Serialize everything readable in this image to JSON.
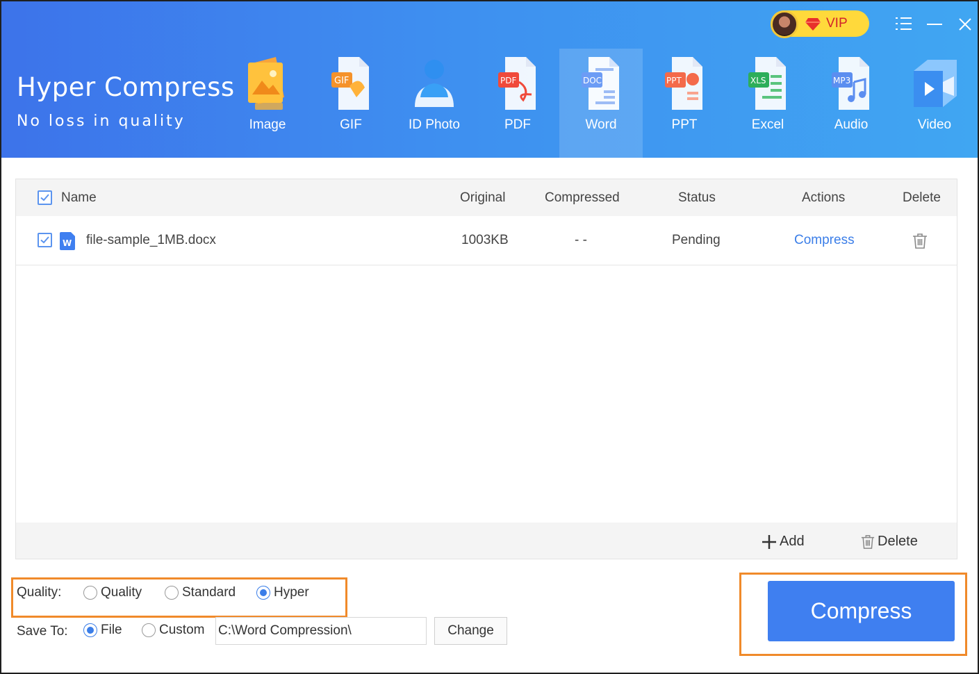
{
  "app": {
    "title": "Hyper Compress",
    "subtitle": "No loss in quality",
    "vip_label": "VIP"
  },
  "tools": [
    {
      "label": "Image",
      "icon": "image-icon",
      "active": false
    },
    {
      "label": "GIF",
      "icon": "gif-icon",
      "active": false
    },
    {
      "label": "ID Photo",
      "icon": "id-photo-icon",
      "active": false
    },
    {
      "label": "PDF",
      "icon": "pdf-icon",
      "active": false
    },
    {
      "label": "Word",
      "icon": "word-doc-icon",
      "active": true
    },
    {
      "label": "PPT",
      "icon": "ppt-icon",
      "active": false
    },
    {
      "label": "Excel",
      "icon": "excel-icon",
      "active": false
    },
    {
      "label": "Audio",
      "icon": "audio-icon",
      "active": false
    },
    {
      "label": "Video",
      "icon": "video-icon",
      "active": false
    }
  ],
  "table": {
    "headers": {
      "name": "Name",
      "original": "Original",
      "compressed": "Compressed",
      "status": "Status",
      "actions": "Actions",
      "delete": "Delete"
    },
    "rows": [
      {
        "name": "file-sample_1MB.docx",
        "original": "1003KB",
        "compressed": "- -",
        "status": "Pending",
        "action": "Compress",
        "checked": true
      }
    ],
    "footer": {
      "add": "Add",
      "delete": "Delete"
    }
  },
  "options": {
    "quality_label": "Quality:",
    "quality_choices": [
      "Quality",
      "Standard",
      "Hyper"
    ],
    "quality_selected": "Hyper",
    "save_label": "Save To:",
    "save_choices": [
      "File",
      "Custom"
    ],
    "save_selected": "File",
    "save_path": "C:\\Word Compression\\",
    "change_label": "Change"
  },
  "compress_button": "Compress",
  "colors": {
    "accent": "#3f7ff0",
    "highlight": "#f08a2a",
    "vip": "#ffd93b"
  }
}
